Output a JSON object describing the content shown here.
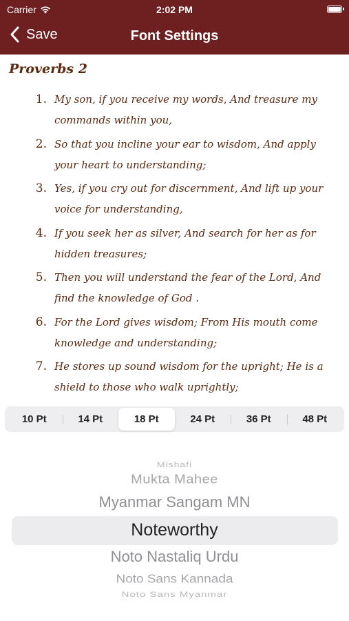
{
  "status_bar": {
    "carrier": "Carrier",
    "time": "2:02 PM"
  },
  "nav": {
    "back_label": "Save",
    "title": "Font Settings"
  },
  "preview": {
    "chapter_title": "Proverbs 2",
    "verses": [
      {
        "num": "1.",
        "text": "My son, if you receive my words, And treasure my commands within you,"
      },
      {
        "num": "2.",
        "text": "So that you incline your ear to wisdom, And apply your heart to understanding;"
      },
      {
        "num": "3.",
        "text": "Yes, if you cry out for discernment, And lift up your voice for understanding,"
      },
      {
        "num": "4.",
        "text": "If you seek her as silver, And search for her as for hidden treasures;"
      },
      {
        "num": "5.",
        "text": "Then you will understand the fear of the Lord, And find the knowledge of God ."
      },
      {
        "num": "6.",
        "text": "For the Lord gives wisdom; From His mouth come knowledge and understanding;"
      },
      {
        "num": "7.",
        "text": "He stores up sound wisdom for the upright; He is a shield to those who walk uprightly;"
      }
    ]
  },
  "font_sizes": {
    "options": [
      "10 Pt",
      "14 Pt",
      "18 Pt",
      "24 Pt",
      "36 Pt",
      "48 Pt"
    ],
    "selected": "18 Pt"
  },
  "font_picker": {
    "items": [
      "",
      "Mishafi",
      "Mukta Mahee",
      "Myanmar Sangam MN",
      "Noteworthy",
      "Noto Nastaliq Urdu",
      "Noto Sans Kannada",
      "Noto Sans Myanmar",
      ""
    ],
    "selected": "Noteworthy"
  },
  "colors": {
    "nav_background": "#6e1f1f",
    "text_color": "#5a2a10"
  },
  "icons": {
    "back": "chevron-left-icon",
    "wifi": "wifi-icon",
    "battery": "battery-icon"
  }
}
